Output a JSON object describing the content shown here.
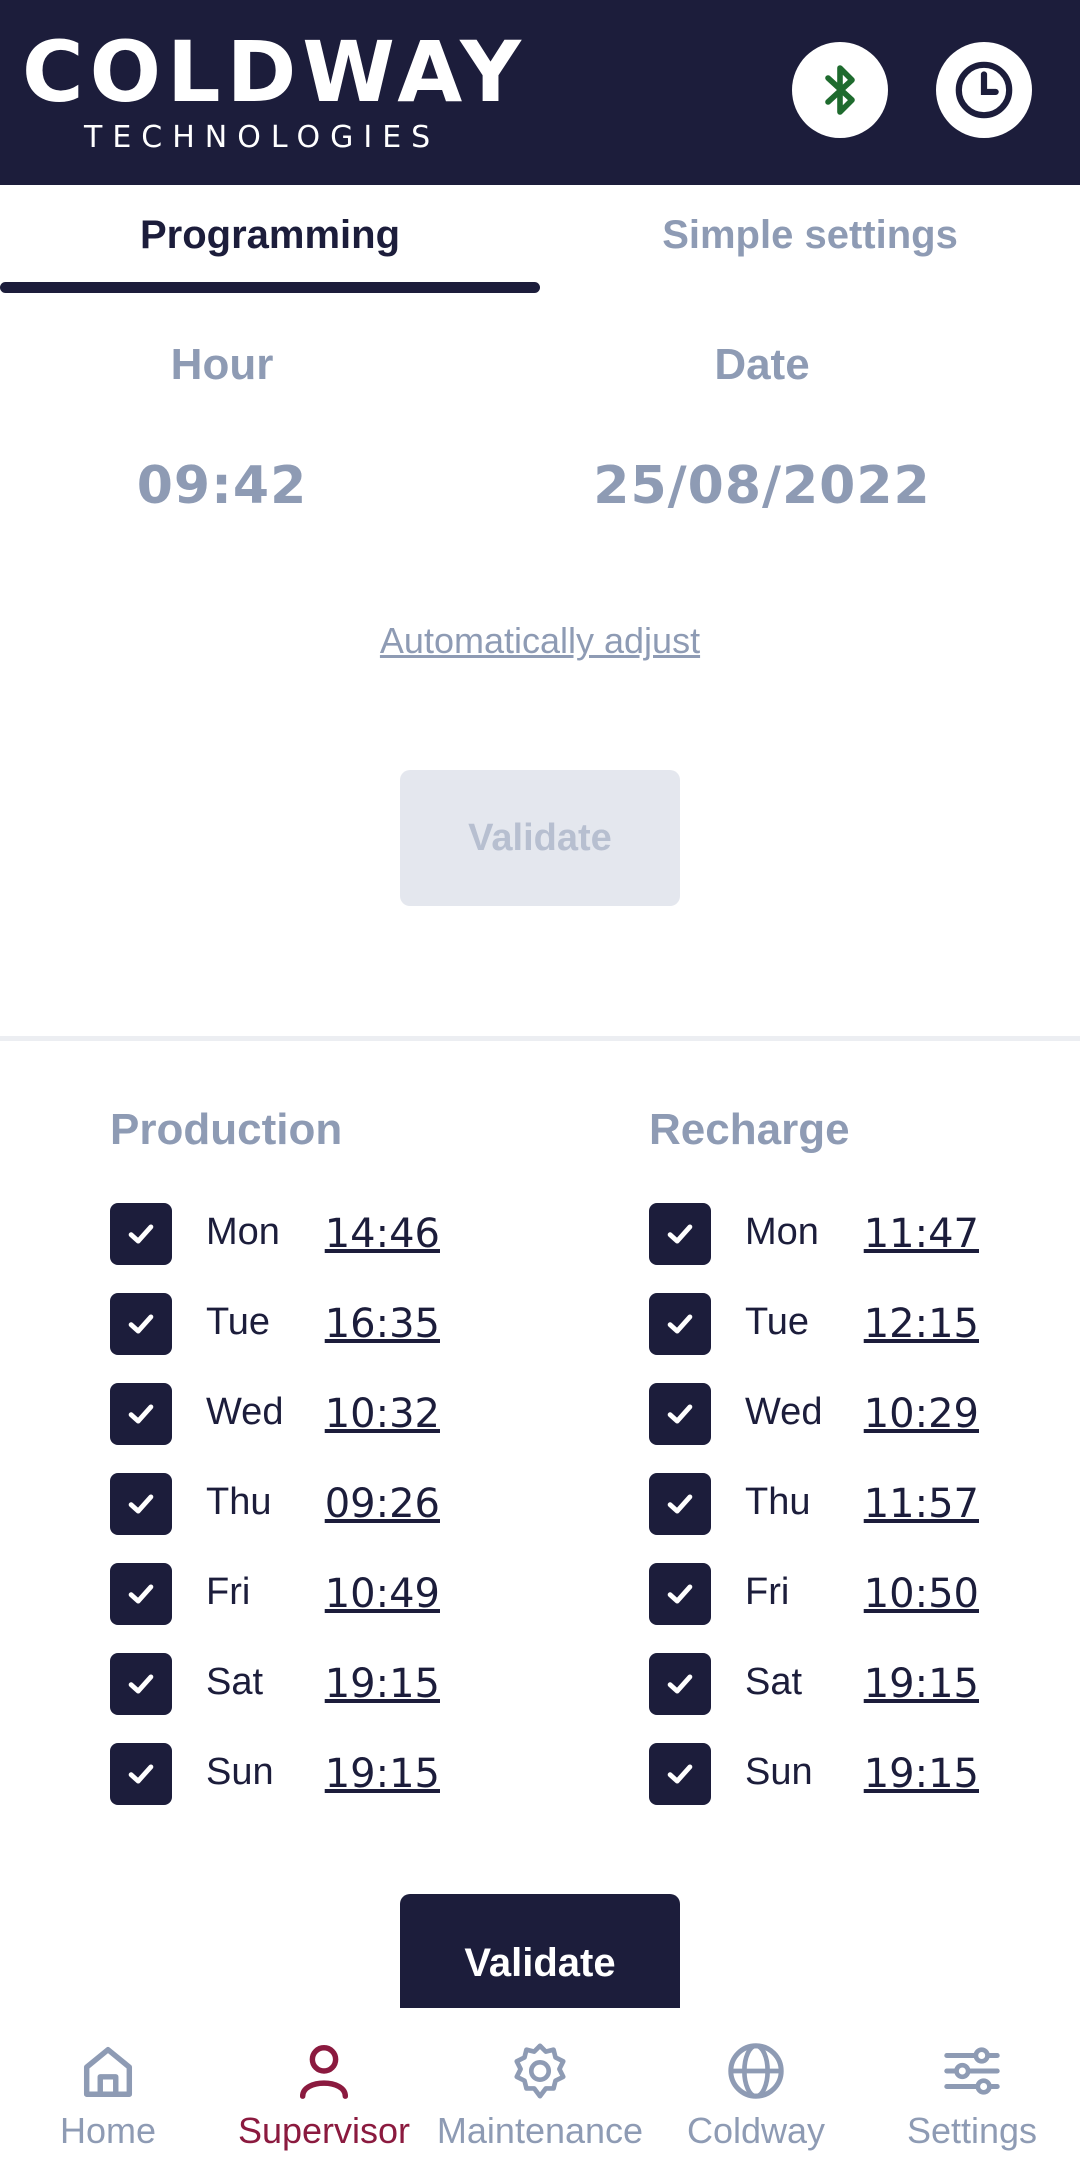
{
  "header": {
    "logo_main": "COLDWAY",
    "logo_sub": "TECHNOLOGIES",
    "bluetooth_icon": "bluetooth-icon",
    "clock_icon": "clock-icon"
  },
  "tabs": [
    {
      "label": "Programming",
      "active": true
    },
    {
      "label": "Simple settings",
      "active": false
    }
  ],
  "clock": {
    "hour_label": "Hour",
    "hour_value": "09:42",
    "date_label": "Date",
    "date_value": "25/08/2022",
    "auto_adjust": "Automatically adjust",
    "validate_label": "Validate"
  },
  "schedule": {
    "production": {
      "title": "Production",
      "rows": [
        {
          "day": "Mon",
          "time": "14:46",
          "checked": true
        },
        {
          "day": "Tue",
          "time": "16:35",
          "checked": true
        },
        {
          "day": "Wed",
          "time": "10:32",
          "checked": true
        },
        {
          "day": "Thu",
          "time": "09:26",
          "checked": true
        },
        {
          "day": "Fri",
          "time": "10:49",
          "checked": true
        },
        {
          "day": "Sat",
          "time": "19:15",
          "checked": true
        },
        {
          "day": "Sun",
          "time": "19:15",
          "checked": true
        }
      ]
    },
    "recharge": {
      "title": "Recharge",
      "rows": [
        {
          "day": "Mon",
          "time": "11:47",
          "checked": true
        },
        {
          "day": "Tue",
          "time": "12:15",
          "checked": true
        },
        {
          "day": "Wed",
          "time": "10:29",
          "checked": true
        },
        {
          "day": "Thu",
          "time": "11:57",
          "checked": true
        },
        {
          "day": "Fri",
          "time": "10:50",
          "checked": true
        },
        {
          "day": "Sat",
          "time": "19:15",
          "checked": true
        },
        {
          "day": "Sun",
          "time": "19:15",
          "checked": true
        }
      ]
    },
    "validate_label": "Validate"
  },
  "nav": [
    {
      "label": "Home",
      "icon": "home-icon",
      "active": false
    },
    {
      "label": "Supervisor",
      "icon": "person-icon",
      "active": true
    },
    {
      "label": "Maintenance",
      "icon": "gear-icon",
      "active": false
    },
    {
      "label": "Coldway",
      "icon": "globe-icon",
      "active": false
    },
    {
      "label": "Settings",
      "icon": "sliders-icon",
      "active": false
    }
  ],
  "colors": {
    "primary": "#1c1d3b",
    "muted": "#8e9bb4",
    "nav_active": "#8b1a3f",
    "bluetooth": "#1e6b2e"
  }
}
